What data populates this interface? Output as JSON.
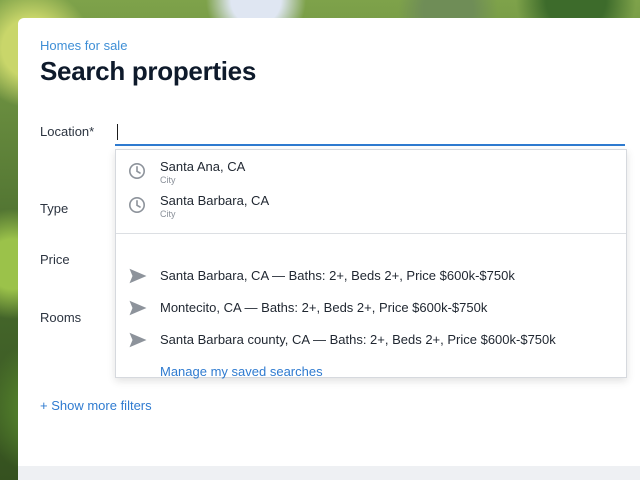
{
  "header": {
    "eyebrow": "Homes for sale",
    "title": "Search properties"
  },
  "form": {
    "location_label": "Location*",
    "location_value": "",
    "type_label": "Type",
    "price_label": "Price",
    "rooms_label": "Rooms",
    "show_more_filters": "+ Show more filters"
  },
  "suggestions": {
    "recent": [
      {
        "name": "Santa Ana, CA",
        "kind": "City",
        "icon": "clock-icon"
      },
      {
        "name": "Santa Barbara, CA",
        "kind": "City",
        "icon": "clock-icon"
      }
    ],
    "saved": [
      {
        "text": "Santa Barbara, CA — Baths: 2+, Beds 2+, Price $600k-$750k",
        "icon": "send-icon"
      },
      {
        "text": "Montecito, CA — Baths: 2+, Beds 2+, Price $600k-$750k",
        "icon": "send-icon"
      },
      {
        "text": "Santa Barbara county, CA — Baths: 2+, Beds 2+, Price $600k-$750k",
        "icon": "send-icon"
      }
    ],
    "manage_label": "Manage my saved searches"
  },
  "colors": {
    "accent": "#2f7bd0",
    "title": "#0e1a2b",
    "icon": "#8d939b"
  }
}
